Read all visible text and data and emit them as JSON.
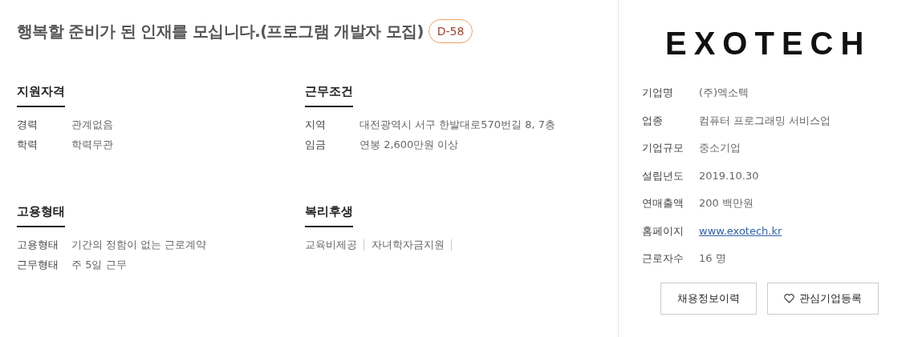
{
  "posting": {
    "title": "행복할 준비가 된 인재를 모십니다.(프로그램 개발자 모집)",
    "dday": "D-58"
  },
  "sections": [
    {
      "kind": "table",
      "heading": "지원자격",
      "rows": [
        {
          "label": "경력",
          "value": "관계없음"
        },
        {
          "label": "학력",
          "value": "학력무관"
        }
      ]
    },
    {
      "kind": "table",
      "heading": "근무조건",
      "rows": [
        {
          "label": "지역",
          "value": "대전광역시 서구 한발대로570번길 8, 7층"
        },
        {
          "label": "임금",
          "value": "연봉 2,600만원 이상"
        }
      ]
    },
    {
      "kind": "table",
      "heading": "고용형태",
      "rows": [
        {
          "label": "고용형태",
          "value": "기간의 정함이 없는 근로계약"
        },
        {
          "label": "근무형태",
          "value": "주 5일 근무"
        }
      ]
    },
    {
      "kind": "tags",
      "heading": "복리후생",
      "items": [
        "교육비제공",
        "자녀학자금지원"
      ]
    }
  ],
  "company": {
    "logo": "EXOTECH",
    "info": [
      {
        "label": "기업명",
        "value": "(주)엑소텍"
      },
      {
        "label": "업종",
        "value": "컴퓨터 프로그래밍 서비스업"
      },
      {
        "label": "기업규모",
        "value": "중소기업"
      },
      {
        "label": "설립년도",
        "value": "2019.10.30"
      },
      {
        "label": "연매출액",
        "value": "200 백만원"
      },
      {
        "kind": "link",
        "label": "홈페이지",
        "value": "www.exotech.kr"
      },
      {
        "label": "근로자수",
        "value": "16 명"
      }
    ],
    "buttons": [
      {
        "label": "채용정보이력"
      },
      {
        "kind": "favorite",
        "label": "관심기업등록"
      }
    ]
  }
}
